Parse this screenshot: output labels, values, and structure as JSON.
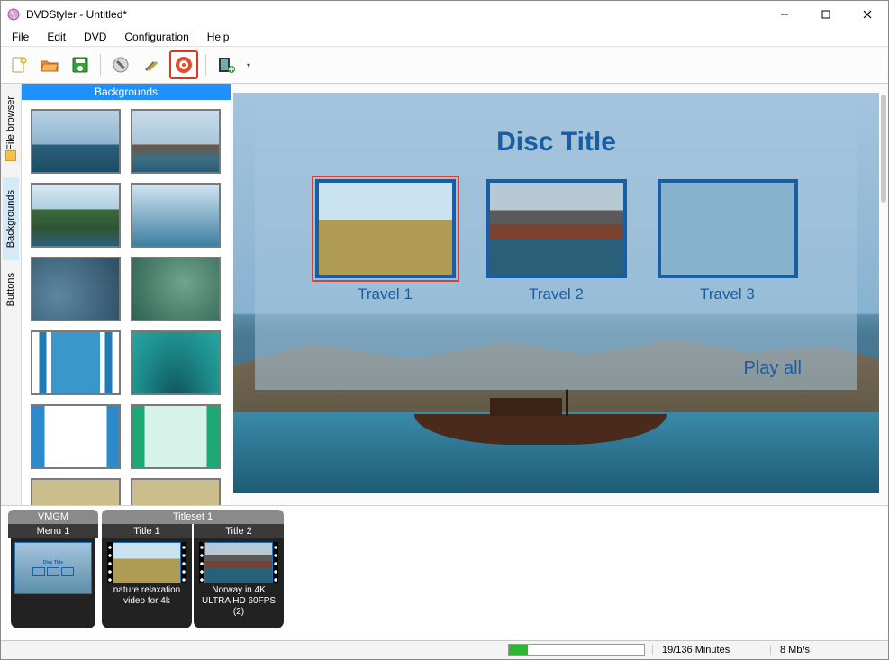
{
  "window": {
    "title": "DVDStyler - Untitled*"
  },
  "menu": {
    "items": [
      "File",
      "Edit",
      "DVD",
      "Configuration",
      "Help"
    ]
  },
  "toolbar": {
    "buttons": [
      {
        "name": "new-project-icon"
      },
      {
        "name": "open-project-icon"
      },
      {
        "name": "save-project-icon"
      },
      {
        "sep": true
      },
      {
        "name": "options-icon"
      },
      {
        "name": "settings-icon"
      },
      {
        "name": "burn-disc-icon",
        "highlight": true
      },
      {
        "sep": true
      },
      {
        "name": "add-title-icon",
        "dropdown": true
      }
    ]
  },
  "side_tabs": [
    {
      "label": "File browser",
      "name": "tab-file-browser",
      "active": false,
      "icon": true
    },
    {
      "label": "Backgrounds",
      "name": "tab-backgrounds",
      "active": true,
      "icon": false
    },
    {
      "label": "Buttons",
      "name": "tab-buttons",
      "active": false,
      "icon": false
    }
  ],
  "gallery": {
    "header": "Backgrounds",
    "items": [
      {
        "name": "bg-ocean",
        "cls": "bg-ocean"
      },
      {
        "name": "bg-shipwreck",
        "cls": "bg-ship"
      },
      {
        "name": "bg-coastline",
        "cls": "bg-coast"
      },
      {
        "name": "bg-blue-gradient",
        "cls": "bg-grad-blue"
      },
      {
        "name": "bg-blue-blur",
        "cls": "bg-blur-blue"
      },
      {
        "name": "bg-green-blur",
        "cls": "bg-blur-green"
      },
      {
        "name": "bg-blue-stripes",
        "cls": "bg-stripe-blue"
      },
      {
        "name": "bg-teal-wave",
        "cls": "bg-wave-teal"
      },
      {
        "name": "bg-blue-frame",
        "cls": "bg-frame-blue"
      },
      {
        "name": "bg-green-frame",
        "cls": "bg-frame-green"
      },
      {
        "name": "bg-plain",
        "cls": "bg-plain"
      },
      {
        "name": "bg-plain-2",
        "cls": "bg-plain"
      }
    ]
  },
  "preview": {
    "title": "Disc Title",
    "items": [
      {
        "label": "Travel 1",
        "name": "menu-btn-travel-1",
        "cls": "bg-grass",
        "selected": true
      },
      {
        "label": "Travel 2",
        "name": "menu-btn-travel-2",
        "cls": "bg-town",
        "selected": false
      },
      {
        "label": "Travel 3",
        "name": "menu-btn-travel-3",
        "cls": "",
        "selected": false
      }
    ],
    "play_all": "Play all"
  },
  "timeline": {
    "vmgm": {
      "head": "VMGM",
      "sub": "Menu 1",
      "caption": ""
    },
    "titleset": {
      "head": "Titleset 1",
      "titles": [
        {
          "sub": "Title 1",
          "caption": "nature relaxation video for 4k",
          "cls": "bg-grass"
        },
        {
          "sub": "Title 2",
          "caption": "Norway in 4K ULTRA HD 60FPS (2)",
          "cls": "bg-town"
        }
      ]
    }
  },
  "status": {
    "progress_pct": 14,
    "duration": "19/136 Minutes",
    "bitrate": "8 Mb/s"
  }
}
